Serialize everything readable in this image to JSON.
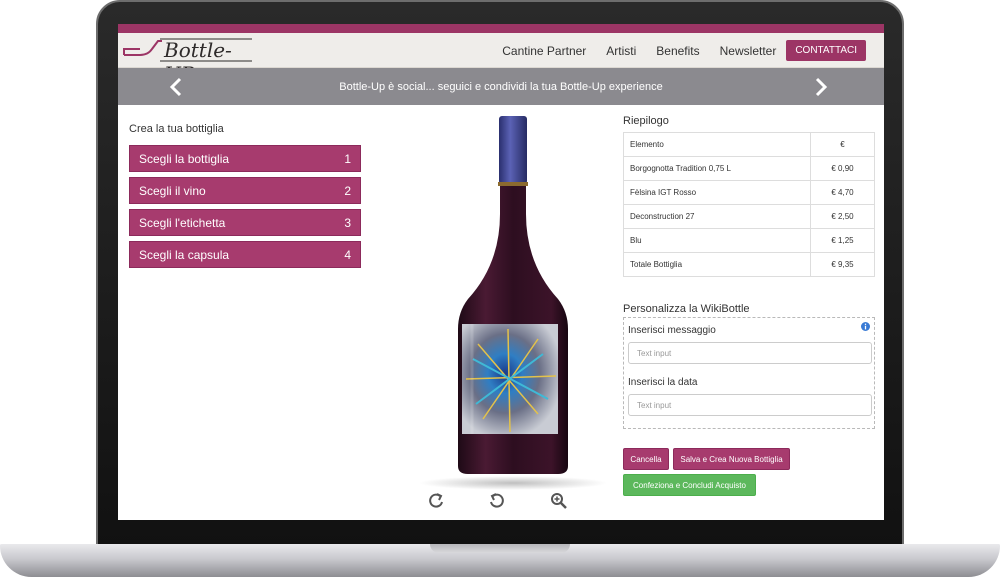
{
  "colors": {
    "accent": "#9c3565",
    "step_bg": "#a73b6e",
    "banner": "#8b8a8f",
    "green": "#5cb85c"
  },
  "logo": {
    "text": "Bottle-UP"
  },
  "nav": {
    "items": [
      "Cantine Partner",
      "Artisti",
      "Benefits",
      "Newsletter"
    ],
    "cta": "CONTATTACI"
  },
  "banner": {
    "text": "Bottle-Up è social... seguici e condividi la tua Bottle-Up experience"
  },
  "builder": {
    "title": "Crea la tua bottiglia",
    "steps": [
      {
        "label": "Scegli la bottiglia",
        "num": "1"
      },
      {
        "label": "Scegli il vino",
        "num": "2"
      },
      {
        "label": "Scegli l'etichetta",
        "num": "3"
      },
      {
        "label": "Scegli la capsula",
        "num": "4"
      }
    ]
  },
  "viewer_tools": [
    "rotate-right-icon",
    "rotate-left-icon",
    "zoom-in-icon"
  ],
  "summary": {
    "title": "Riepilogo",
    "header": {
      "item": "Elemento",
      "value": "€"
    },
    "rows": [
      {
        "item": "Borgognotta Tradition 0,75 L",
        "value": "€ 0,90"
      },
      {
        "item": "Fèlsina IGT Rosso",
        "value": "€ 4,70"
      },
      {
        "item": "Deconstruction 27",
        "value": "€ 2,50"
      },
      {
        "item": "Blu",
        "value": "€ 1,25"
      },
      {
        "item": "Totale Bottiglia",
        "value": "€ 9,35"
      }
    ]
  },
  "personalize": {
    "title": "Personalizza la WikiBottle",
    "message_label": "Inserisci messaggio",
    "message_placeholder": "Text input",
    "date_label": "Inserisci la data",
    "date_placeholder": "Text input"
  },
  "actions": {
    "cancel": "Cancella",
    "save_new": "Salva e Crea Nuova Bottiglia",
    "checkout": "Confeziona e Concludi Acquisto"
  }
}
